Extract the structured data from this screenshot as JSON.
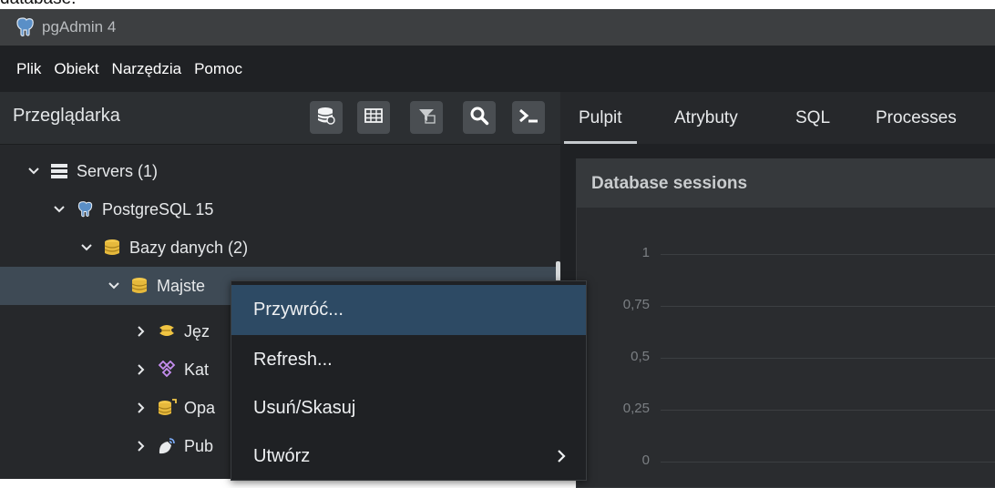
{
  "top_fragment": "database.",
  "window": {
    "title": "pgAdmin 4"
  },
  "menu": [
    "Plik",
    "Obiekt",
    "Narzędzia",
    "Pomoc"
  ],
  "browser": {
    "title": "Przeglądarka"
  },
  "tree": [
    {
      "label": "Servers (1)",
      "icon": "servers-icon"
    },
    {
      "label": "PostgreSQL 15",
      "icon": "postgresql-icon"
    },
    {
      "label": "Bazy danych (2)",
      "icon": "databases-icon"
    },
    {
      "label": "Majste",
      "icon": "database-icon"
    },
    {
      "label": "Jęz",
      "icon": "languages-icon"
    },
    {
      "label": "Kat",
      "icon": "catalogs-icon"
    },
    {
      "label": "Opa",
      "icon": "event-triggers-icon"
    },
    {
      "label": "Pub",
      "icon": "publications-icon"
    }
  ],
  "tabs": [
    "Pulpit",
    "Atrybuty",
    "SQL",
    "Processes"
  ],
  "dashboard": {
    "card_title": "Database sessions",
    "y_ticks": [
      "1",
      "0,75",
      "0,5",
      "0,25",
      "0"
    ]
  },
  "context_menu": [
    "Przywróć...",
    "Refresh...",
    "Usuń/Skasuj",
    "Utwórz"
  ],
  "colors": {
    "accent_highlight": "#2d4a64",
    "menubar": "#1f2124",
    "titlebar": "#3d3f41"
  }
}
